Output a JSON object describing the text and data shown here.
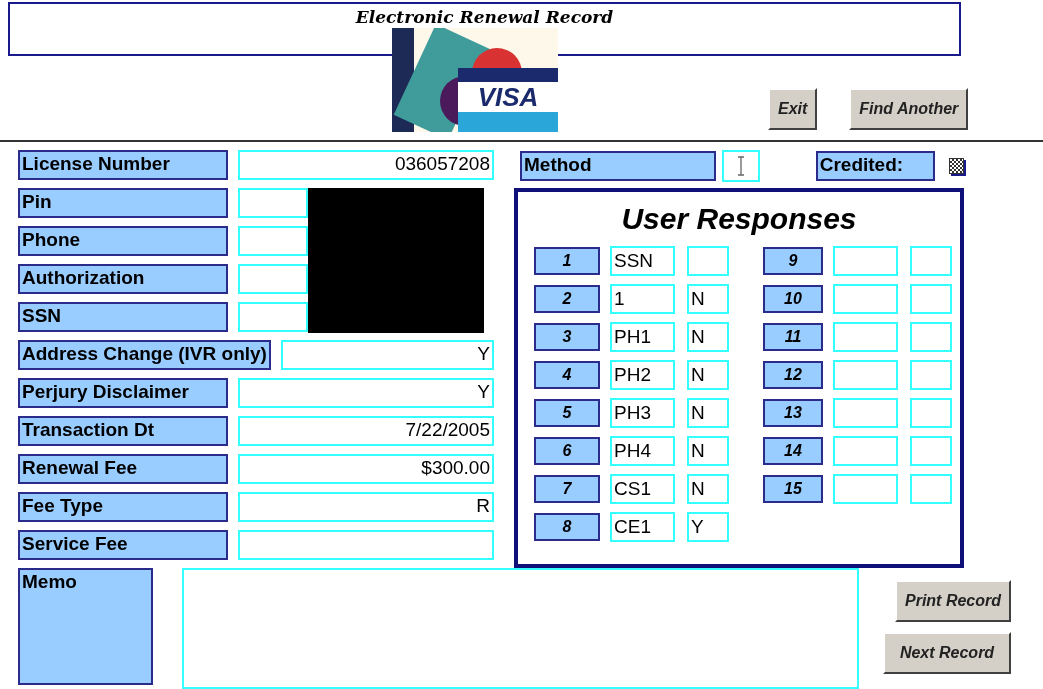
{
  "header": {
    "title": "Electronic Renewal Record",
    "logo_text": "VISA"
  },
  "top_buttons": [
    {
      "label": "Exit"
    },
    {
      "label": "Find Another"
    }
  ],
  "fields": [
    {
      "label": "License Number",
      "value": "036057208",
      "redacted": false
    },
    {
      "label": "Pin",
      "redacted": true
    },
    {
      "label": "Phone",
      "redacted": true
    },
    {
      "label": "Authorization",
      "redacted": true
    },
    {
      "label": "SSN",
      "redacted": true
    },
    {
      "label": "Address Change (IVR only)",
      "value": "Y",
      "redacted": false
    },
    {
      "label": "Perjury Disclaimer",
      "value": "Y",
      "redacted": false
    },
    {
      "label": "Transaction Dt",
      "value": "7/22/2005",
      "redacted": false
    },
    {
      "label": "Renewal Fee",
      "value": "$300.00",
      "redacted": false
    },
    {
      "label": "Fee Type",
      "value": "R",
      "redacted": false
    },
    {
      "label": "Service Fee",
      "redacted": false
    }
  ],
  "method": {
    "label": "Method"
  },
  "credited": {
    "label": "Credited:",
    "indeterminate": true
  },
  "user_responses": {
    "title": "User Responses",
    "rows": [
      {
        "number": "1",
        "code": "SSN"
      },
      {
        "number": "2",
        "code": "1",
        "answer": "N"
      },
      {
        "number": "3",
        "code": "PH1",
        "answer": "N"
      },
      {
        "number": "4",
        "code": "PH2",
        "answer": "N"
      },
      {
        "number": "5",
        "code": "PH3",
        "answer": "N"
      },
      {
        "number": "6",
        "code": "PH4",
        "answer": "N"
      },
      {
        "number": "7",
        "code": "CS1",
        "answer": "N"
      },
      {
        "number": "8",
        "code": "CE1",
        "answer": "Y"
      },
      {
        "number": "9"
      },
      {
        "number": "10"
      },
      {
        "number": "11"
      },
      {
        "number": "12"
      },
      {
        "number": "13"
      },
      {
        "number": "14"
      },
      {
        "number": "15"
      }
    ]
  },
  "memo": {
    "label": "Memo"
  },
  "bottom_buttons": [
    {
      "label": "Print Record"
    },
    {
      "label": "Next Record"
    }
  ]
}
